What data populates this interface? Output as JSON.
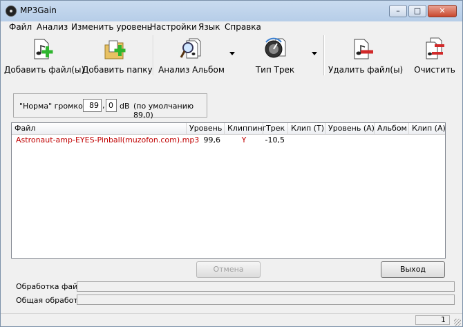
{
  "window": {
    "title": "MP3Gain"
  },
  "titlebar_buttons": {
    "minimize": "–",
    "maximize": "□",
    "close": "✕"
  },
  "menu": [
    "Файл",
    "Анализ",
    "Изменить уровень",
    "Настройки",
    "Язык",
    "Справка"
  ],
  "toolbar": {
    "add_files": "Добавить файл(ы)",
    "add_folder": "Добавить папку",
    "album_analysis": "Анализ Альбом",
    "track_type": "Тип Трек",
    "remove_files": "Удалить файл(ы)",
    "clear": "Очистить"
  },
  "norm": {
    "label": "\"Норма\" громкости:",
    "int_value": "89",
    "sep": ",",
    "frac_value": "0",
    "unit": "dB",
    "default_hint": "(по умолчанию 89,0)"
  },
  "table": {
    "columns": [
      "Файл",
      "Уровень",
      "Клиппинг",
      "Трек",
      "Клип (Т)",
      "Уровень (A)",
      "Альбом",
      "Клип (A)"
    ],
    "rows": [
      {
        "file": "Astronaut-amp-EYES-Pinball(muzofon.com).mp3",
        "level": "99,6",
        "clipping": "Y",
        "track": "-10,5"
      }
    ]
  },
  "buttons": {
    "cancel": "Отмена",
    "exit": "Выход"
  },
  "progress": {
    "file_label": "Обработка файла",
    "total_label": "Общая обработка"
  },
  "status": {
    "count": "1"
  },
  "colors": {
    "row_text": "#c00000",
    "add_plus": "#2fb52f",
    "remove_minus": "#d12a2a"
  }
}
